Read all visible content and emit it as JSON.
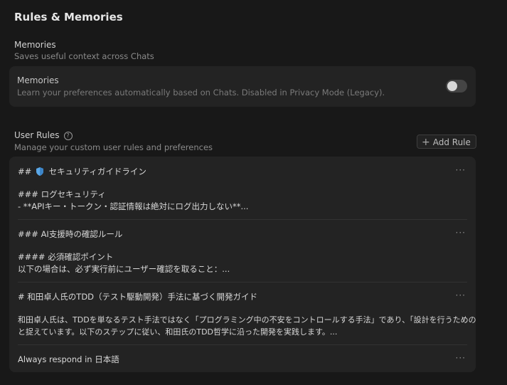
{
  "page": {
    "title": "Rules & Memories"
  },
  "memories_section": {
    "title": "Memories",
    "description": "Saves useful context across Chats",
    "card": {
      "title": "Memories",
      "description": "Learn your preferences automatically based on Chats. Disabled in Privacy Mode (Legacy).",
      "toggle_on": false
    }
  },
  "user_rules_section": {
    "title": "User Rules",
    "description": "Manage your custom user rules and preferences",
    "add_rule_label": "Add Rule",
    "help_glyph": "?",
    "more_glyph": "···",
    "rules": [
      {
        "heading_prefix": "##",
        "heading": "セキュリティガイドライン",
        "line2": "### ログセキュリティ",
        "line3": "- **APIキー・トークン・認証情報は絶対にログ出力しない**..."
      },
      {
        "heading": "### AI支援時の確認ルール",
        "line2": "#### 必須確認ポイント",
        "line3": "以下の場合は、必ず実行前にユーザー確認を取ること：..."
      },
      {
        "heading": "# 和田卓人氏のTDD（テスト駆動開発）手法に基づく開発ガイド",
        "line2": "和田卓人氏は、TDDを単なるテスト手法ではなく「プログラミング中の不安をコントロールする手法」であり、「設計を行うためのもの」",
        "line3": "と捉えています。以下のステップに従い、和田氏のTDD哲学に沿った開発を実践します。..."
      },
      {
        "heading": "Always respond in 日本語"
      }
    ]
  }
}
